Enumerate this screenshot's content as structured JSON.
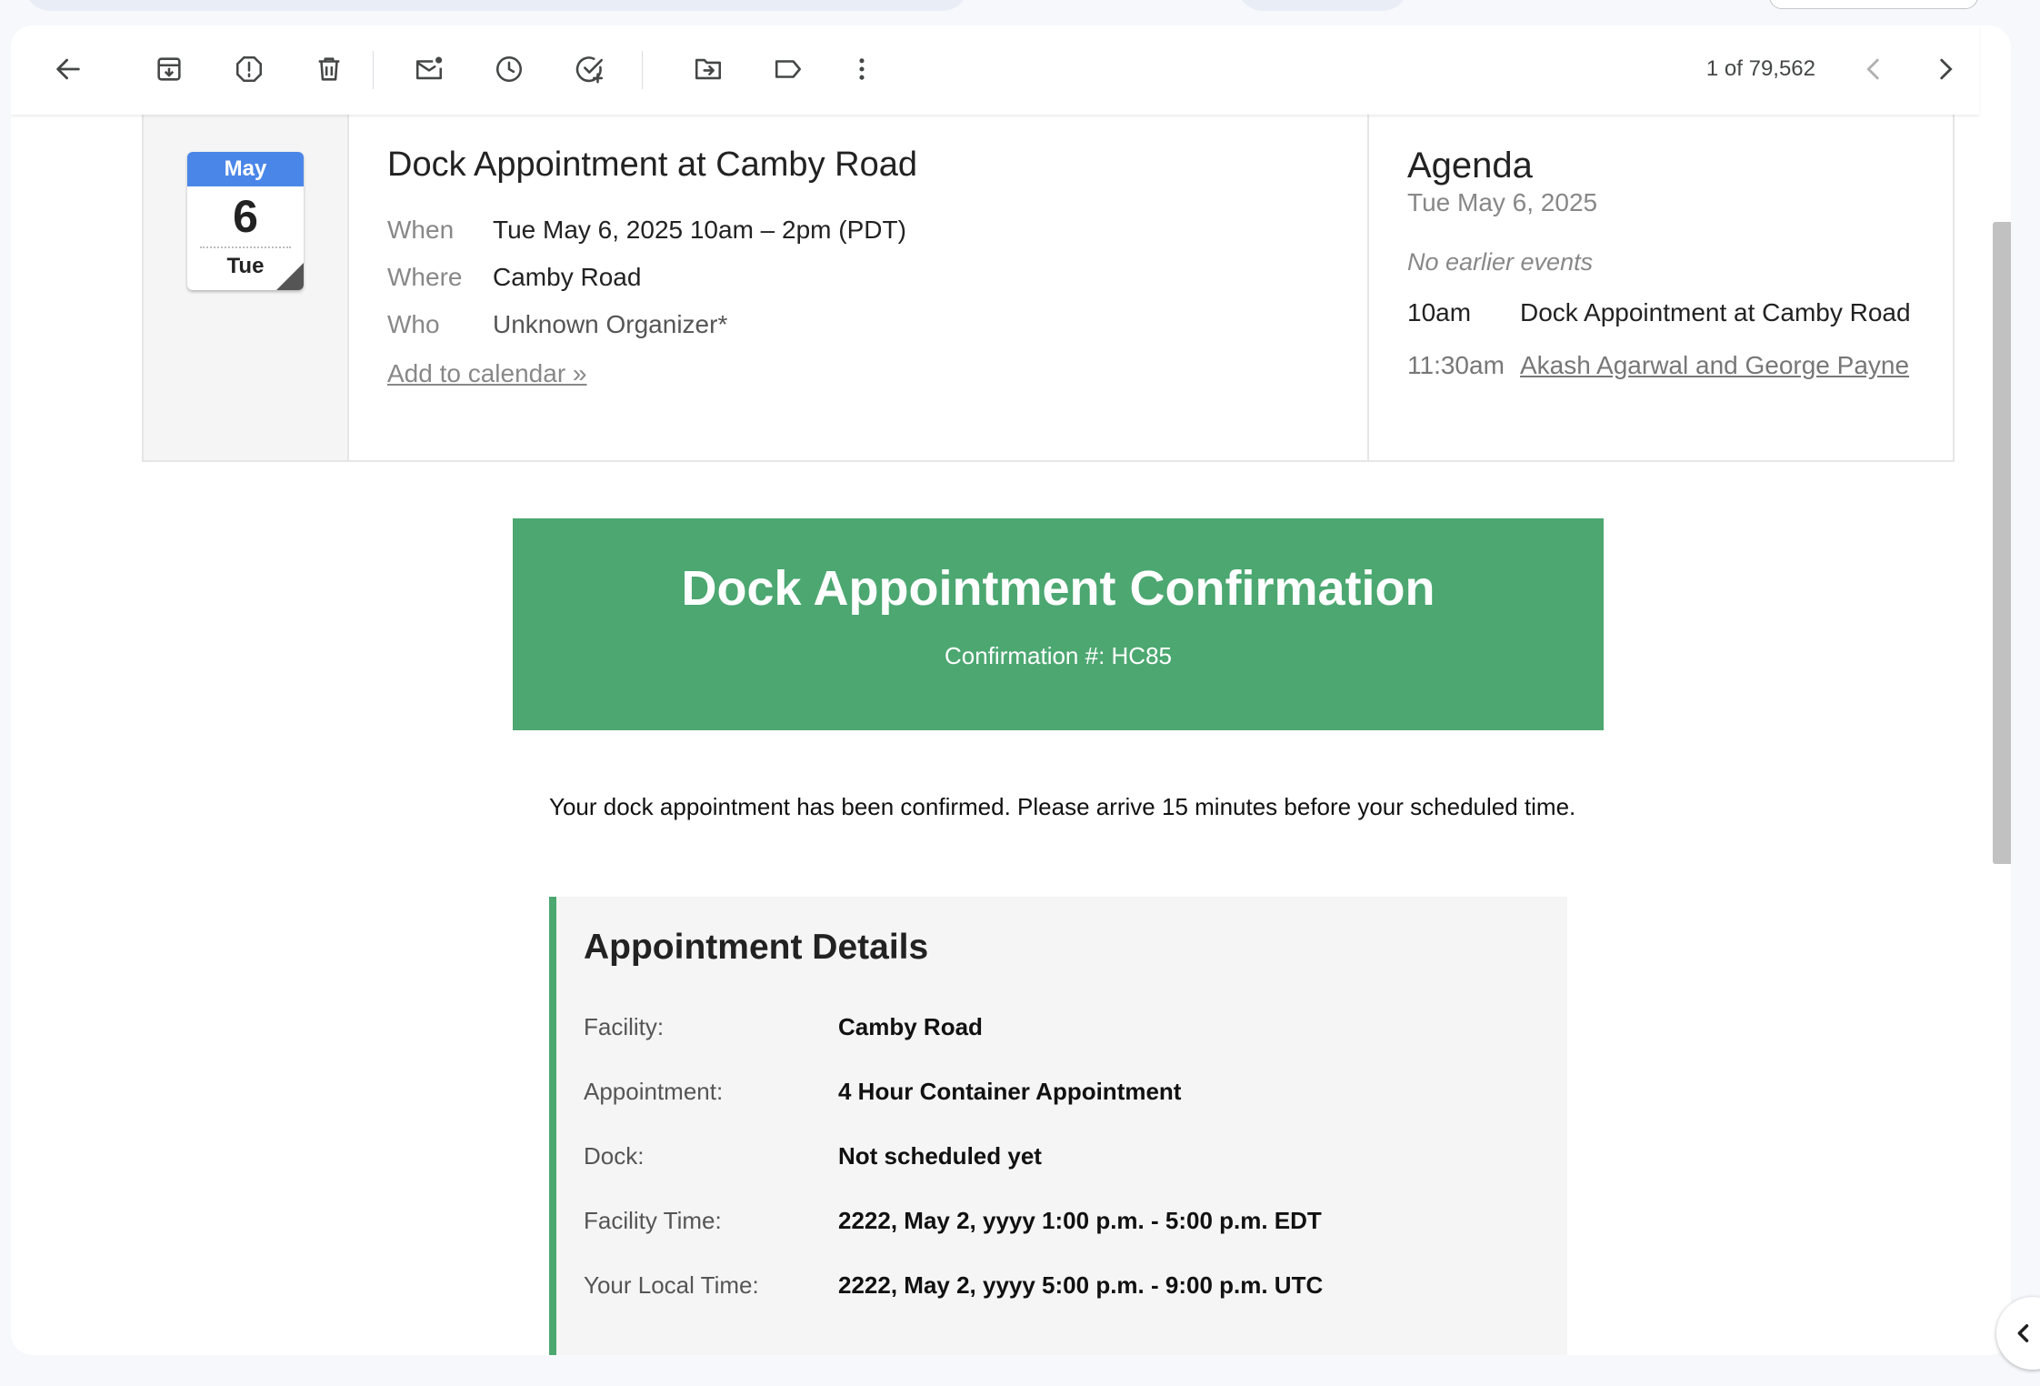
{
  "toolbar": {
    "back": "arrow-left-icon",
    "archive": "archive-icon",
    "spam": "report-spam-icon",
    "delete": "trash-icon",
    "mark_unread": "mark-unread-icon",
    "snooze": "snooze-clock-icon",
    "add_task": "add-task-icon",
    "move": "move-to-folder-icon",
    "label": "label-icon",
    "more": "more-vert-icon",
    "pager": "1 of 79,562"
  },
  "invite": {
    "month": "May",
    "day": "6",
    "weekday": "Tue",
    "title": "Dock Appointment at Camby Road",
    "rows": [
      {
        "key": "When",
        "value": "Tue May 6, 2025 10am – 2pm (PDT)"
      },
      {
        "key": "Where",
        "value": "Camby Road"
      },
      {
        "key": "Who",
        "value": "Unknown Organizer*"
      }
    ],
    "add_link": "Add to calendar »"
  },
  "agenda": {
    "title": "Agenda",
    "date": "Tue May 6, 2025",
    "none": "No earlier events",
    "events": [
      {
        "time": "10am",
        "title": "Dock Appointment at Camby Road"
      },
      {
        "time": "11:30am",
        "title": "Akash Agarwal and George Payne"
      }
    ]
  },
  "banner": {
    "title": "Dock Appointment Confirmation",
    "confirmation": "Confirmation #: HC85",
    "color": "#4ca771"
  },
  "message": "Your dock appointment has been confirmed. Please arrive 15 minutes before your scheduled time.",
  "details": {
    "heading": "Appointment Details",
    "rows": [
      {
        "key": "Facility:",
        "value": "Camby Road"
      },
      {
        "key": "Appointment:",
        "value": "4 Hour Container Appointment"
      },
      {
        "key": "Dock:",
        "value": "Not scheduled yet"
      },
      {
        "key": "Facility Time:",
        "value": "2222, May 2, yyyy 1:00 p.m. - 5:00 p.m. EDT"
      },
      {
        "key": "Your Local Time:",
        "value": "2222, May 2, yyyy 5:00 p.m. - 9:00 p.m. UTC"
      }
    ]
  }
}
